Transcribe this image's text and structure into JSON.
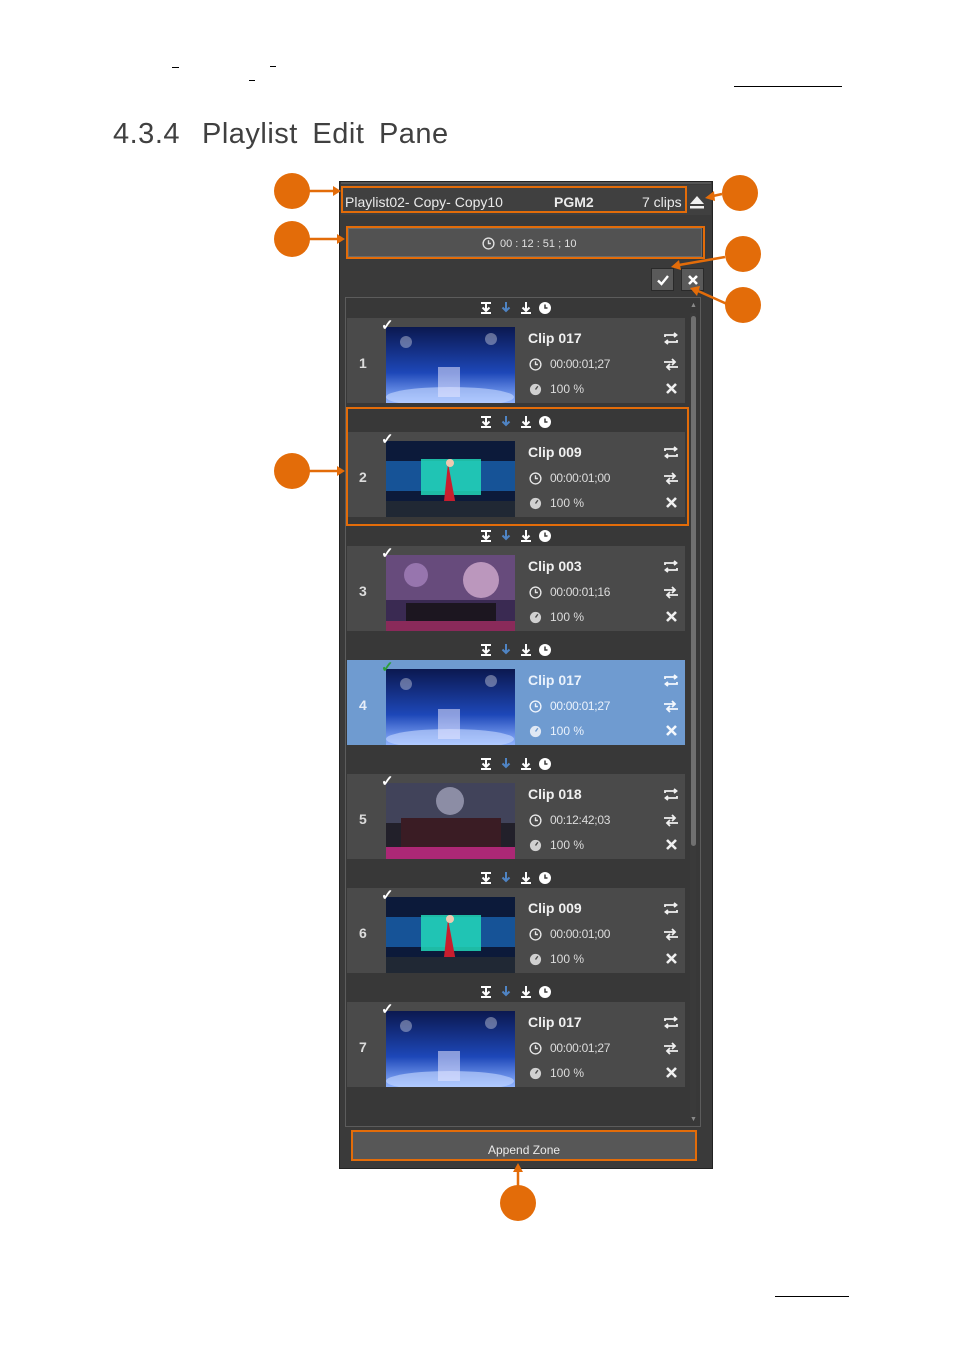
{
  "section": {
    "number": "4.3.4",
    "title": "Playlist Edit Pane"
  },
  "pane": {
    "playlist_name": "Playlist02- Copy- Copy10",
    "channel": "PGM2",
    "clip_count": "7 clips",
    "total_duration": "00 : 12 : 51 ; 10",
    "append_zone": "Append Zone"
  },
  "clips": [
    {
      "index": "1",
      "name": "Clip 017",
      "duration": "00:00:01;27",
      "speed": "100 %",
      "selected": false
    },
    {
      "index": "2",
      "name": "Clip 009",
      "duration": "00:00:01;00",
      "speed": "100 %",
      "selected": false
    },
    {
      "index": "3",
      "name": "Clip 003",
      "duration": "00:00:01;16",
      "speed": "100 %",
      "selected": false
    },
    {
      "index": "4",
      "name": "Clip 017",
      "duration": "00:00:01;27",
      "speed": "100 %",
      "selected": true
    },
    {
      "index": "5",
      "name": "Clip 018",
      "duration": "00:12:42;03",
      "speed": "100 %",
      "selected": false
    },
    {
      "index": "6",
      "name": "Clip 009",
      "duration": "00:00:01;00",
      "speed": "100 %",
      "selected": false
    },
    {
      "index": "7",
      "name": "Clip 017",
      "duration": "00:00:01;27",
      "speed": "100 %",
      "selected": false
    }
  ],
  "colors": {
    "callout": "#e36c09",
    "selected_row": "#6f9bd0",
    "pane_bg": "#3a3a3a"
  }
}
